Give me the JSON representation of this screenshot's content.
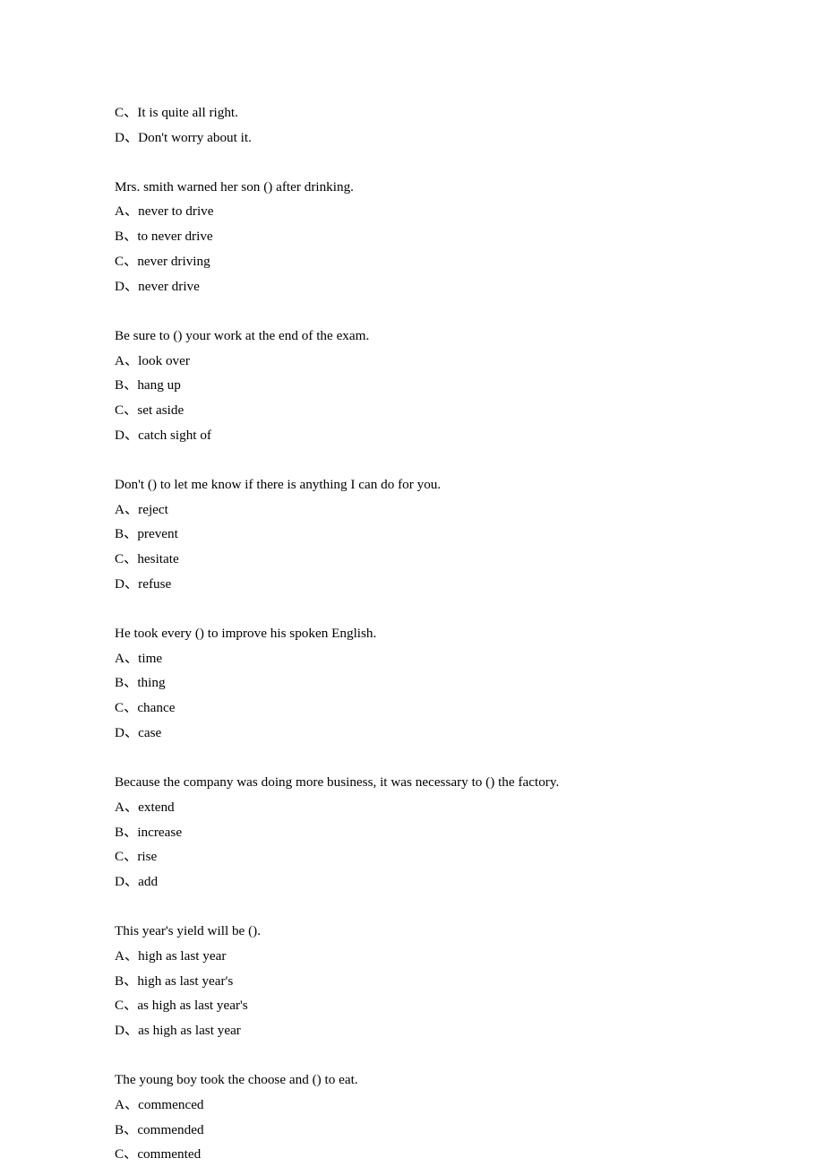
{
  "blocks": [
    {
      "lines": [
        "C、It is quite all right.",
        "D、Don't worry about it."
      ]
    },
    {
      "lines": [
        "Mrs. smith warned her son () after drinking.",
        "A、never to drive",
        "B、to never drive",
        "C、never driving",
        "D、never drive"
      ]
    },
    {
      "lines": [
        "Be sure to () your work at the end of the exam.",
        "A、look over",
        "B、hang up",
        "C、set aside",
        "D、catch sight of"
      ]
    },
    {
      "lines": [
        "Don't () to let me know if there is anything I can do for you.",
        "A、reject",
        "B、prevent",
        "C、hesitate",
        "D、refuse"
      ]
    },
    {
      "lines": [
        "He took every () to improve his spoken English.",
        "A、time",
        "B、thing",
        "C、chance",
        "D、case"
      ]
    },
    {
      "lines": [
        "Because the company was doing more business, it was necessary to () the factory.",
        "A、extend",
        "B、increase",
        "C、rise",
        "D、add"
      ]
    },
    {
      "lines": [
        "This year's yield will be ().",
        "A、high as last year",
        "B、high as last year's",
        "C、as high as last year's",
        "D、as high as last year"
      ]
    },
    {
      "lines": [
        "The young boy took the choose and () to eat.",
        "A、commenced",
        "B、commended",
        "C、commented"
      ]
    }
  ]
}
